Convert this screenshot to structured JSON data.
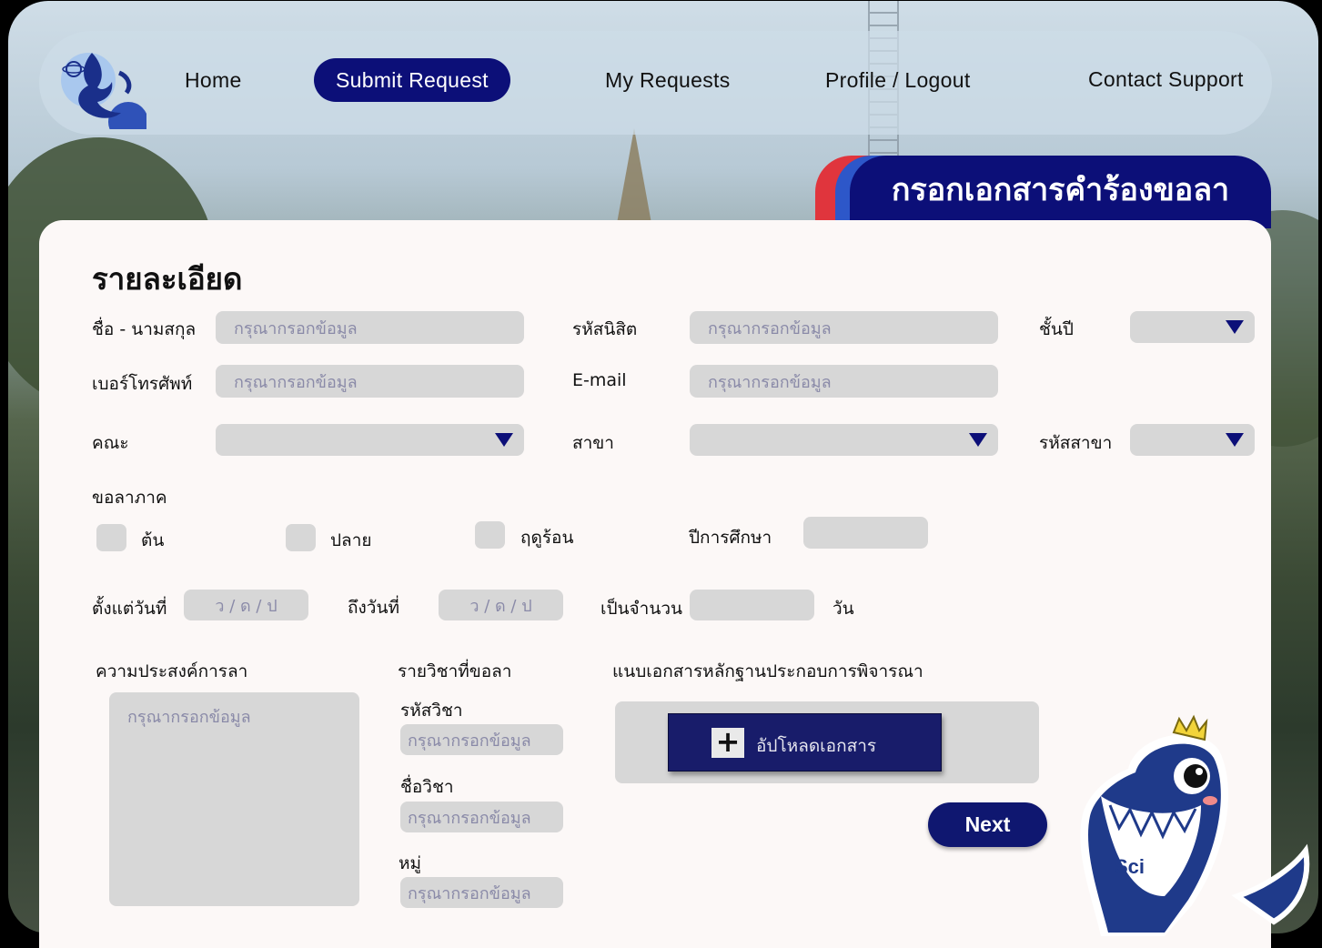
{
  "nav": {
    "items": [
      {
        "label": "Home"
      },
      {
        "label": "Submit Request"
      },
      {
        "label": "My Requests"
      },
      {
        "label": "Profile / Logout"
      },
      {
        "label": "Contact Support"
      }
    ]
  },
  "form": {
    "title_tab": "กรอกเอกสารคำร้องขอลา",
    "section_heading": "รายละเอียด",
    "placeholder": "กรุณากรอกข้อมูล",
    "date_placeholder": "ว / ด / ป",
    "fields": {
      "name_label": "ชื่อ - นามสกุล",
      "student_id_label": "รหัสนิสิต",
      "year_label": "ชั้นปี",
      "phone_label": "เบอร์โทรศัพท์",
      "email_label": "E-mail",
      "faculty_label": "คณะ",
      "major_label": "สาขา",
      "major_code_label": "รหัสสาขา",
      "semester_label": "ขอลาภาค",
      "semester_first": "ต้น",
      "semester_second": "ปลาย",
      "semester_summer": "ฤดูร้อน",
      "academic_year_label": "ปีการศึกษา",
      "from_date_label": "ตั้งแต่วันที่",
      "to_date_label": "ถึงวันที่",
      "amount_label": "เป็นจำนวน",
      "days_unit": "วัน",
      "purpose_label": "ความประสงค์การลา",
      "course_label": "รายวิชาที่ขอลา",
      "course_code_label": "รหัสวิชา",
      "course_name_label": "ชื่อวิชา",
      "section_label": "หมู่",
      "attachment_label": "แนบเอกสารหลักฐานประกอบการพิจารณา",
      "upload_button": "อัปโหลดเอกสาร",
      "next_button": "Next"
    }
  },
  "colors": {
    "primary": "#0c0f78",
    "panel": "#fcf8f7",
    "input_bg": "#d7d7d7",
    "accent_red": "#e0353d",
    "accent_blue": "#2d57c9"
  },
  "icons": [
    "faculty-logo-icon",
    "chevron-down-icon",
    "plus-icon",
    "whale-mascot-icon"
  ]
}
